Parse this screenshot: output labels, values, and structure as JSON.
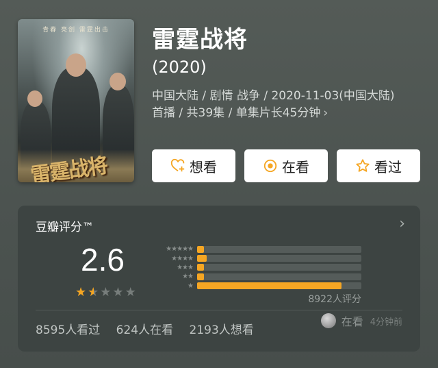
{
  "poster": {
    "tagline": "青春 亮剑 雷霆出击",
    "title_art": "雷霆战将"
  },
  "header": {
    "title": "雷霆战将",
    "year": "(2020)",
    "meta_line1": "中国大陆 / 剧情 战争 / 2020-11-03(中国大陆)",
    "meta_line2": "首播 / 共39集 / 单集片长45分钟",
    "meta_chevron": "›"
  },
  "actions": [
    {
      "label": "想看",
      "icon": "heart-plus-icon"
    },
    {
      "label": "在看",
      "icon": "target-icon"
    },
    {
      "label": "看过",
      "icon": "star-outline-icon"
    }
  ],
  "rating": {
    "title": "豆瓣评分™",
    "score": "2.6",
    "stars_filled": 1.5,
    "stars_total": 5,
    "distribution": [
      {
        "stars": "★★★★★",
        "fraction": 0.04
      },
      {
        "stars": "★★★★",
        "fraction": 0.06
      },
      {
        "stars": "★★★",
        "fraction": 0.04
      },
      {
        "stars": "★★",
        "fraction": 0.04
      },
      {
        "stars": "★",
        "fraction": 0.88
      }
    ],
    "total": "8922人评分",
    "counts": {
      "watched": "8595人看过",
      "watching": "624人在看",
      "wish": "2193人想看"
    },
    "recent": {
      "label": "在看",
      "time": "4分钟前"
    }
  },
  "colors": {
    "accent": "#f5a623",
    "background": "#4f5653",
    "card": "#3d4442"
  }
}
